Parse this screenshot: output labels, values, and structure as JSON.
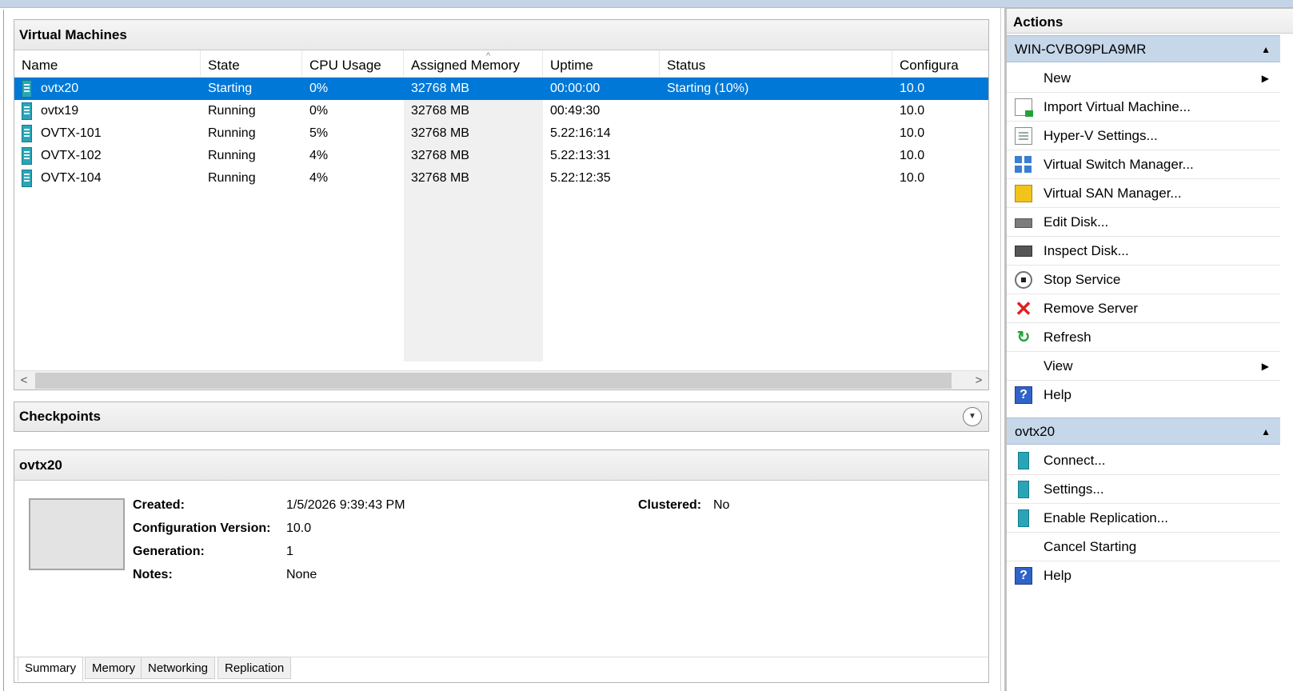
{
  "vm_panel": {
    "title": "Virtual Machines",
    "columns": [
      "Name",
      "State",
      "CPU Usage",
      "Assigned Memory",
      "Uptime",
      "Status",
      "Configura"
    ],
    "rows": [
      {
        "name": "ovtx20",
        "state": "Starting",
        "cpu": "0%",
        "memory": "32768 MB",
        "uptime": "00:00:00",
        "status": "Starting (10%)",
        "config": "10.0",
        "selected": true
      },
      {
        "name": "ovtx19",
        "state": "Running",
        "cpu": "0%",
        "memory": "32768 MB",
        "uptime": "00:49:30",
        "status": "",
        "config": "10.0"
      },
      {
        "name": "OVTX-101",
        "state": "Running",
        "cpu": "5%",
        "memory": "32768 MB",
        "uptime": "5.22:16:14",
        "status": "",
        "config": "10.0"
      },
      {
        "name": "OVTX-102",
        "state": "Running",
        "cpu": "4%",
        "memory": "32768 MB",
        "uptime": "5.22:13:31",
        "status": "",
        "config": "10.0"
      },
      {
        "name": "OVTX-104",
        "state": "Running",
        "cpu": "4%",
        "memory": "32768 MB",
        "uptime": "5.22:12:35",
        "status": "",
        "config": "10.0"
      }
    ],
    "scroll_left": "<",
    "scroll_right": ">"
  },
  "checkpoints": {
    "title": "Checkpoints"
  },
  "details": {
    "title": "ovtx20",
    "created_label": "Created:",
    "created_value": "1/5/2026 9:39:43 PM",
    "config_label": "Configuration Version:",
    "config_value": "10.0",
    "generation_label": "Generation:",
    "generation_value": "1",
    "notes_label": "Notes:",
    "notes_value": "None",
    "clustered_label": "Clustered:",
    "clustered_value": "No",
    "tabs": [
      "Summary",
      "Memory",
      "Networking",
      "Replication"
    ]
  },
  "actions": {
    "title": "Actions",
    "server_group": {
      "title": "WIN-CVBO9PLA9MR",
      "items": [
        {
          "label": "New",
          "icon": "none",
          "submenu": true
        },
        {
          "label": "Import Virtual Machine...",
          "icon": "import-icon"
        },
        {
          "label": "Hyper-V Settings...",
          "icon": "settings-doc-icon"
        },
        {
          "label": "Virtual Switch Manager...",
          "icon": "switch-icon"
        },
        {
          "label": "Virtual SAN Manager...",
          "icon": "san-icon"
        },
        {
          "label": "Edit Disk...",
          "icon": "edit-disk-icon"
        },
        {
          "label": "Inspect Disk...",
          "icon": "inspect-disk-icon"
        },
        {
          "label": "Stop Service",
          "icon": "stop-icon"
        },
        {
          "label": "Remove Server",
          "icon": "x-icon"
        },
        {
          "label": "Refresh",
          "icon": "refresh-icon"
        },
        {
          "label": "View",
          "icon": "none",
          "submenu": true
        },
        {
          "label": "Help",
          "icon": "help-icon"
        }
      ]
    },
    "vm_group": {
      "title": "ovtx20",
      "items": [
        {
          "label": "Connect...",
          "icon": "connect-icon"
        },
        {
          "label": "Settings...",
          "icon": "vm-settings-icon"
        },
        {
          "label": "Enable Replication...",
          "icon": "replication-icon"
        },
        {
          "label": "Cancel Starting",
          "icon": "none"
        },
        {
          "label": "Help",
          "icon": "help-icon"
        }
      ]
    },
    "glyphs": {
      "submenu": "▶",
      "collapse": "▲",
      "help": "?",
      "remove": "✕",
      "refresh": "↻",
      "expand": "▼"
    }
  }
}
